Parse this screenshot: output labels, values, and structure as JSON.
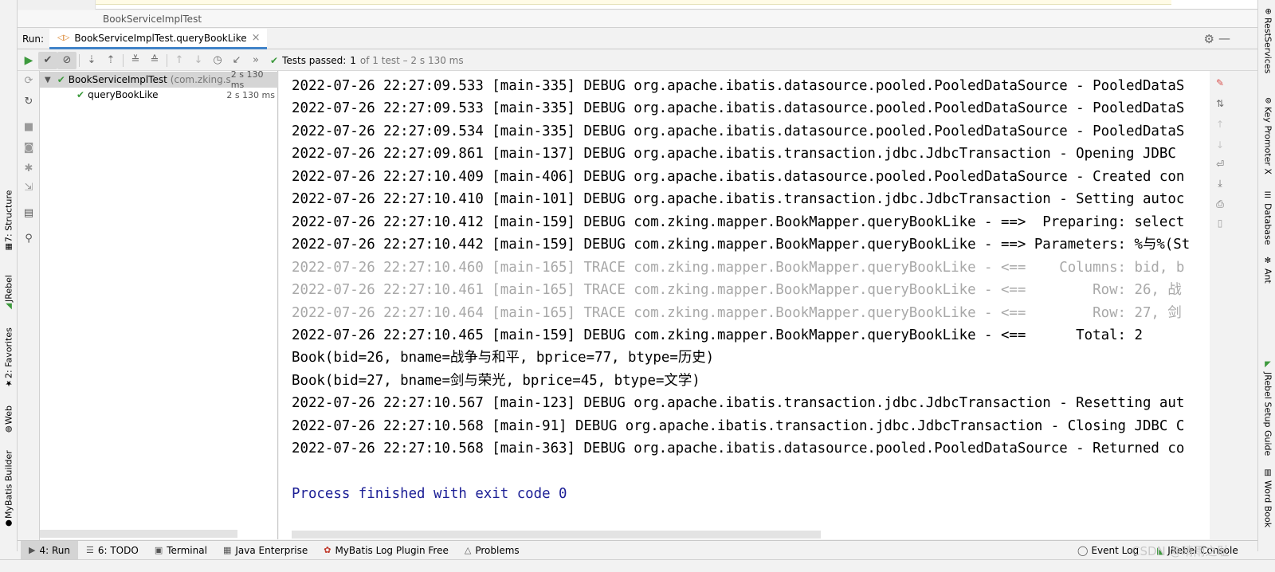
{
  "window": {
    "breadcrumb": "BookServiceImplTest"
  },
  "run_tool": {
    "label": "Run:",
    "tab": "BookServiceImplTest.queryBookLike",
    "status_prefix": "Tests passed:",
    "status_count": "1",
    "status_suffix": "of 1 test – 2 s 130 ms"
  },
  "tree": [
    {
      "name": "BookServiceImplTest",
      "package": "(com.zking.se",
      "time": "2 s 130 ms"
    },
    {
      "name": "queryBookLike",
      "package": "",
      "time": "2 s 130 ms"
    }
  ],
  "console": {
    "lines": [
      {
        "text": "2022-07-26 22:27:09.533 [main-335] DEBUG org.apache.ibatis.datasource.pooled.PooledDataSource - PooledDataS",
        "style": "debug"
      },
      {
        "text": "2022-07-26 22:27:09.533 [main-335] DEBUG org.apache.ibatis.datasource.pooled.PooledDataSource - PooledDataS",
        "style": "debug"
      },
      {
        "text": "2022-07-26 22:27:09.534 [main-335] DEBUG org.apache.ibatis.datasource.pooled.PooledDataSource - PooledDataS",
        "style": "debug"
      },
      {
        "text": "2022-07-26 22:27:09.861 [main-137] DEBUG org.apache.ibatis.transaction.jdbc.JdbcTransaction - Opening JDBC",
        "style": "debug"
      },
      {
        "text": "2022-07-26 22:27:10.409 [main-406] DEBUG org.apache.ibatis.datasource.pooled.PooledDataSource - Created con",
        "style": "debug"
      },
      {
        "text": "2022-07-26 22:27:10.410 [main-101] DEBUG org.apache.ibatis.transaction.jdbc.JdbcTransaction - Setting autoc",
        "style": "debug"
      },
      {
        "text": "2022-07-26 22:27:10.412 [main-159] DEBUG com.zking.mapper.BookMapper.queryBookLike - ==>  Preparing: select",
        "style": "debug"
      },
      {
        "text": "2022-07-26 22:27:10.442 [main-159] DEBUG com.zking.mapper.BookMapper.queryBookLike - ==> Parameters: %与%(St",
        "style": "debug"
      },
      {
        "text": "2022-07-26 22:27:10.460 [main-165] TRACE com.zking.mapper.BookMapper.queryBookLike - <==    Columns: bid, b",
        "style": "trace"
      },
      {
        "text": "2022-07-26 22:27:10.461 [main-165] TRACE com.zking.mapper.BookMapper.queryBookLike - <==        Row: 26, 战",
        "style": "trace"
      },
      {
        "text": "2022-07-26 22:27:10.464 [main-165] TRACE com.zking.mapper.BookMapper.queryBookLike - <==        Row: 27, 剑",
        "style": "trace"
      },
      {
        "text": "2022-07-26 22:27:10.465 [main-159] DEBUG com.zking.mapper.BookMapper.queryBookLike - <==      Total: 2",
        "style": "debug"
      },
      {
        "text": "Book(bid=26, bname=战争与和平, bprice=77, btype=历史)",
        "style": "debug"
      },
      {
        "text": "Book(bid=27, bname=剑与荣光, bprice=45, btype=文学)",
        "style": "debug"
      },
      {
        "text": "2022-07-26 22:27:10.567 [main-123] DEBUG org.apache.ibatis.transaction.jdbc.JdbcTransaction - Resetting aut",
        "style": "debug"
      },
      {
        "text": "2022-07-26 22:27:10.568 [main-91] DEBUG org.apache.ibatis.transaction.jdbc.JdbcTransaction - Closing JDBC C",
        "style": "debug"
      },
      {
        "text": "2022-07-26 22:27:10.568 [main-363] DEBUG org.apache.ibatis.datasource.pooled.PooledDataSource - Returned co",
        "style": "debug"
      },
      {
        "text": "",
        "style": "debug"
      },
      {
        "text": "Process finished with exit code 0",
        "style": "proc"
      }
    ]
  },
  "left_stripe": [
    "7: Structure",
    "JRebel",
    "2: Favorites",
    "Web",
    "MyBatis Builder"
  ],
  "right_stripe": [
    "RestServices",
    "Key Promoter X",
    "Database",
    "Ant",
    "JRebel Setup Guide",
    "Word Book"
  ],
  "bottom_tabs": [
    "4: Run",
    "6: TODO",
    "Terminal",
    "Java Enterprise",
    "MyBatis Log Plugin Free",
    "Problems"
  ],
  "bottom_right": {
    "event_log": "Event Log",
    "jrebel_console": "JRebel Console",
    "watermark": "CSDN @晴雨之耻"
  },
  "colors": {
    "accent": "#4083c9",
    "pass": "#3d9a3d",
    "process": "#1b1e95",
    "trace": "#a8a8a8"
  }
}
